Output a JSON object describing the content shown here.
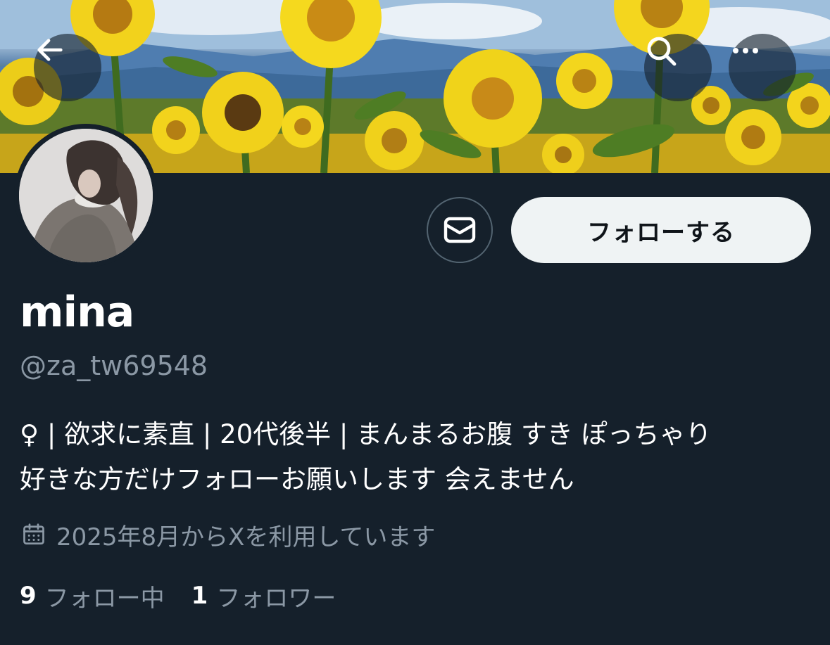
{
  "header": {
    "back_icon": "arrow-left-icon",
    "search_icon": "search-icon",
    "more_icon": "more-horizontal-icon"
  },
  "profile": {
    "display_name": "mina",
    "handle": "@za_tw69548",
    "bio": "♀ | 欲求に素直 | 20代後半 | まんまるお腹 すき ぽっちゃり\n好きな方だけフォローお願いします 会えません",
    "joined_icon": "calendar-icon",
    "joined_text": "2025年8月からXを利用しています"
  },
  "actions": {
    "message_icon": "envelope-icon",
    "follow_label": "フォローする"
  },
  "stats": {
    "following_count": "9",
    "following_label": "フォロー中",
    "followers_count": "1",
    "followers_label": "フォロワー"
  },
  "colors": {
    "background": "#15202b",
    "secondary_text": "#8b98a5",
    "follow_button_bg": "#eff3f4",
    "follow_button_text": "#0f1419"
  }
}
